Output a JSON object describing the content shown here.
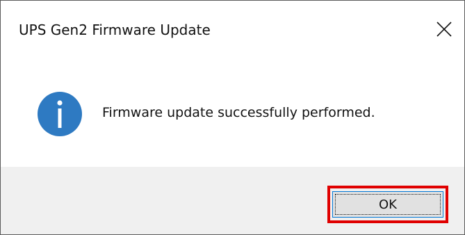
{
  "dialog": {
    "title": "UPS Gen2 Firmware Update",
    "message": "Firmware update successfully performed.",
    "icon": "info-icon"
  },
  "buttons": {
    "ok_label": "OK",
    "close_icon": "close-icon"
  },
  "colors": {
    "info_icon_blue": "#2e7ac2",
    "highlight_red": "#e00000",
    "footer_bg": "#f0f0f0",
    "button_border": "#0078d7"
  }
}
